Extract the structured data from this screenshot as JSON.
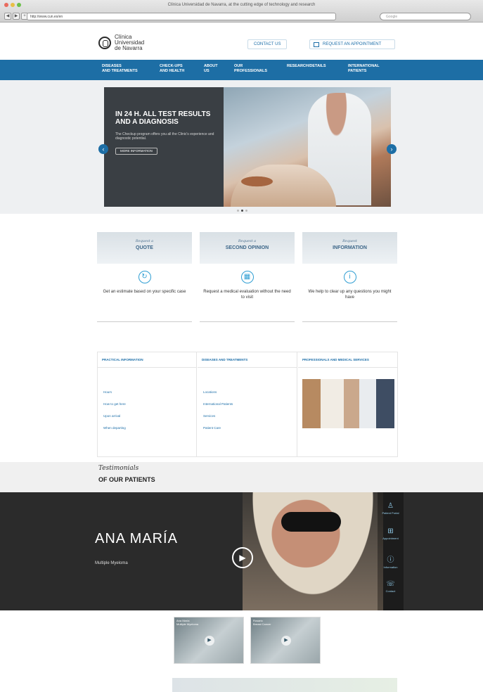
{
  "browser": {
    "window_title": "Clínica Universidad de Navarra, at the cutting edge of technology and research",
    "url": "http://www.cun.es/en",
    "search_placeholder": "Google",
    "nav_buttons": [
      "◀",
      "▶",
      "+"
    ]
  },
  "header": {
    "logo_text": "Clínica\nUniversidad\nde Navarra",
    "contact_label": "CONTACT US",
    "appointment_label": "REQUEST AN APPOINTMENT"
  },
  "nav": {
    "items": [
      {
        "label": "DISEASES\nAND TREATMENTS"
      },
      {
        "label": "CHECK-UPS\nAND HEALTH"
      },
      {
        "label": "ABOUT\nUS"
      },
      {
        "label": "OUR\nPROFESSIONALS"
      },
      {
        "label": "RESEARCH/DETAILS"
      },
      {
        "label": "INTERNATIONAL\nPATIENTS"
      }
    ]
  },
  "hero": {
    "title": "IN 24 H. ALL TEST RESULTS\nAND A DIAGNOSIS",
    "text": "The Checkup program offers you all the Clinic's experience and diagnostic potential.",
    "button": "MORE INFORMATION",
    "prev": "‹",
    "next": "›",
    "slides": 3,
    "active_slide": 2
  },
  "cards": [
    {
      "script": "Request a",
      "big": "QUOTE",
      "icon": "↻",
      "icon_name": "quote-icon",
      "text": "Get an estimate based on your specific case"
    },
    {
      "script": "Request a",
      "big": "SECOND OPINION",
      "icon": "▦",
      "icon_name": "second-opinion-icon",
      "text": "Request a medical evaluation without the need to visit"
    },
    {
      "script": "Request",
      "big": "INFORMATION",
      "icon": "i",
      "icon_name": "information-icon",
      "text": "We help to clear up any questions you might have"
    }
  ],
  "info": {
    "practical": {
      "title": "PRACTICAL INFORMATION",
      "links": [
        "Hours",
        "How to get here",
        "Upon arrival",
        "When departing"
      ]
    },
    "diseases": {
      "title": "DISEASES AND TREATMENTS",
      "links": [
        "Locations",
        "International Patients",
        "Services",
        "Patient Care"
      ]
    },
    "professionals": {
      "title": "PROFESSIONALS AND MEDICAL SERVICES"
    }
  },
  "testimonials": {
    "script": "Testimonials",
    "big": "OF OUR PATIENTS",
    "name": "ANA MARÍA",
    "condition": "Multiple Myeloma",
    "play": "▶"
  },
  "sidebar": {
    "items": [
      {
        "glyph": "♙",
        "icon_name": "patient-icon",
        "label": "Patient Portal"
      },
      {
        "glyph": "⊞",
        "icon_name": "appointment-icon",
        "label": "Appointment"
      },
      {
        "glyph": "ⓘ",
        "icon_name": "info-icon",
        "label": "Information"
      },
      {
        "glyph": "☏",
        "icon_name": "phone-icon",
        "label": "Contact"
      }
    ]
  },
  "thumbs": [
    {
      "caption": "Ana María\nMultiple Myeloma",
      "play": "▶"
    },
    {
      "caption": "Rosario\nBreast Cancer",
      "play": "▶"
    }
  ],
  "colors": {
    "brand_blue": "#1d6ea5",
    "accent_cyan": "#2f9ed3"
  }
}
